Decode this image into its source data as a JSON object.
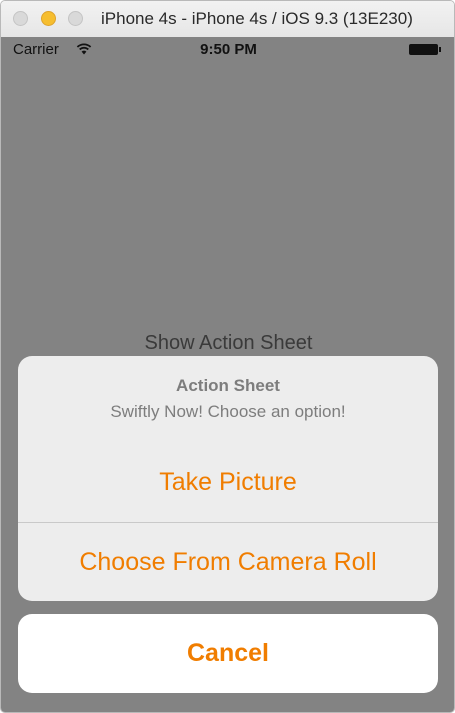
{
  "window": {
    "title": "iPhone 4s - iPhone 4s / iOS 9.3 (13E230)"
  },
  "status_bar": {
    "carrier": "Carrier",
    "time": "9:50 PM",
    "wifi_icon": "wifi-icon",
    "battery_icon": "battery-icon"
  },
  "main": {
    "show_button_label": "Show Action Sheet"
  },
  "action_sheet": {
    "title": "Action Sheet",
    "message": "Swiftly Now! Choose an option!",
    "actions": [
      {
        "label": "Take Picture"
      },
      {
        "label": "Choose From Camera Roll"
      }
    ],
    "cancel_label": "Cancel"
  },
  "colors": {
    "accent": "#f07d00",
    "dimmed_background": "#838383",
    "sheet_background": "#ededed"
  }
}
